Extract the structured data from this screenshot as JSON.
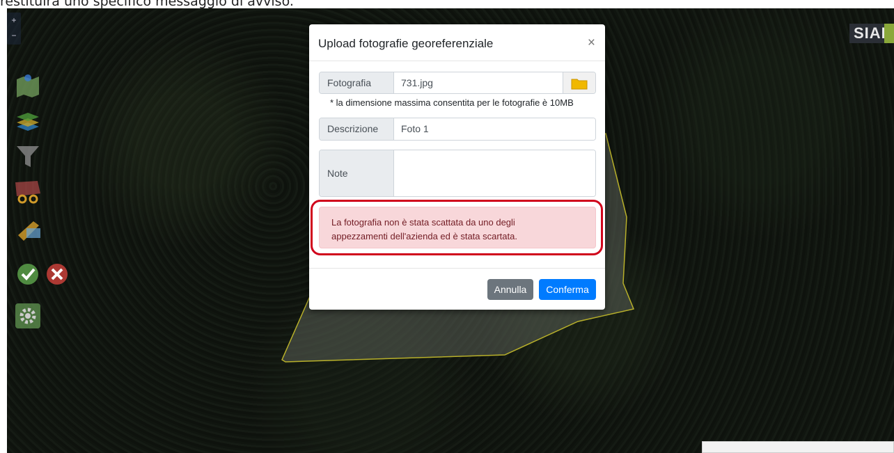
{
  "caption": "restituirà uno specifico messaggio di avviso.",
  "map": {
    "zoom_in": "+",
    "zoom_out": "−",
    "logo_text": "SIAP",
    "tools": [
      {
        "name": "map-icon"
      },
      {
        "name": "layers-icon"
      },
      {
        "name": "filter-icon"
      },
      {
        "name": "cut-icon"
      },
      {
        "name": "draw-icon"
      },
      {
        "name": "confirm-icon"
      },
      {
        "name": "cancel-icon"
      },
      {
        "name": "settings-icon"
      }
    ]
  },
  "modal": {
    "title": "Upload fotografie georeferenziale",
    "close": "×",
    "fotografia_label": "Fotografia",
    "fotografia_value": "731.jpg",
    "hint": "* la dimensione massima consentita per le fotografie è 10MB",
    "descrizione_label": "Descrizione",
    "descrizione_value": "Foto 1",
    "note_label": "Note",
    "note_value": "",
    "alert_line1": "La fotografia non è stata scattata da uno degli",
    "alert_line2": "appezzamenti dell'azienda ed è stata scartata.",
    "cancel_label": "Annulla",
    "confirm_label": "Conferma"
  },
  "colors": {
    "primary": "#007bff",
    "secondary": "#6c757d",
    "alert_bg": "#f8d7da",
    "alert_text": "#721c24",
    "highlight": "#d0021b"
  }
}
